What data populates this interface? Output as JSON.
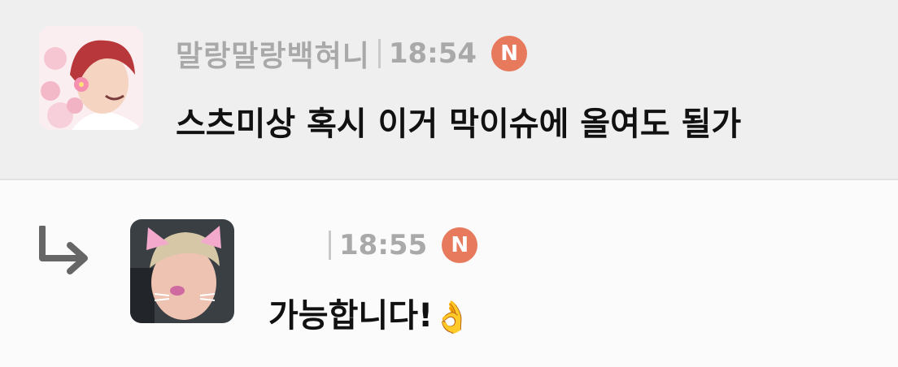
{
  "main_comment": {
    "author": "말랑말랑백혀니",
    "time": "18:54",
    "badge": "N",
    "text": "스츠미상 혹시 이거 막이슈에 올여도 될가"
  },
  "reply_comment": {
    "author": "",
    "time": "18:55",
    "badge": "N",
    "text": "가능합니다!",
    "emoji": "👌"
  },
  "icons": {
    "reply": "reply-arrow-icon",
    "badge": "new-badge-icon"
  },
  "colors": {
    "badge": "#e77a5c",
    "meta_text": "#a9a9a9",
    "main_bg": "#efefef",
    "reply_bg": "#fbfbfb"
  }
}
